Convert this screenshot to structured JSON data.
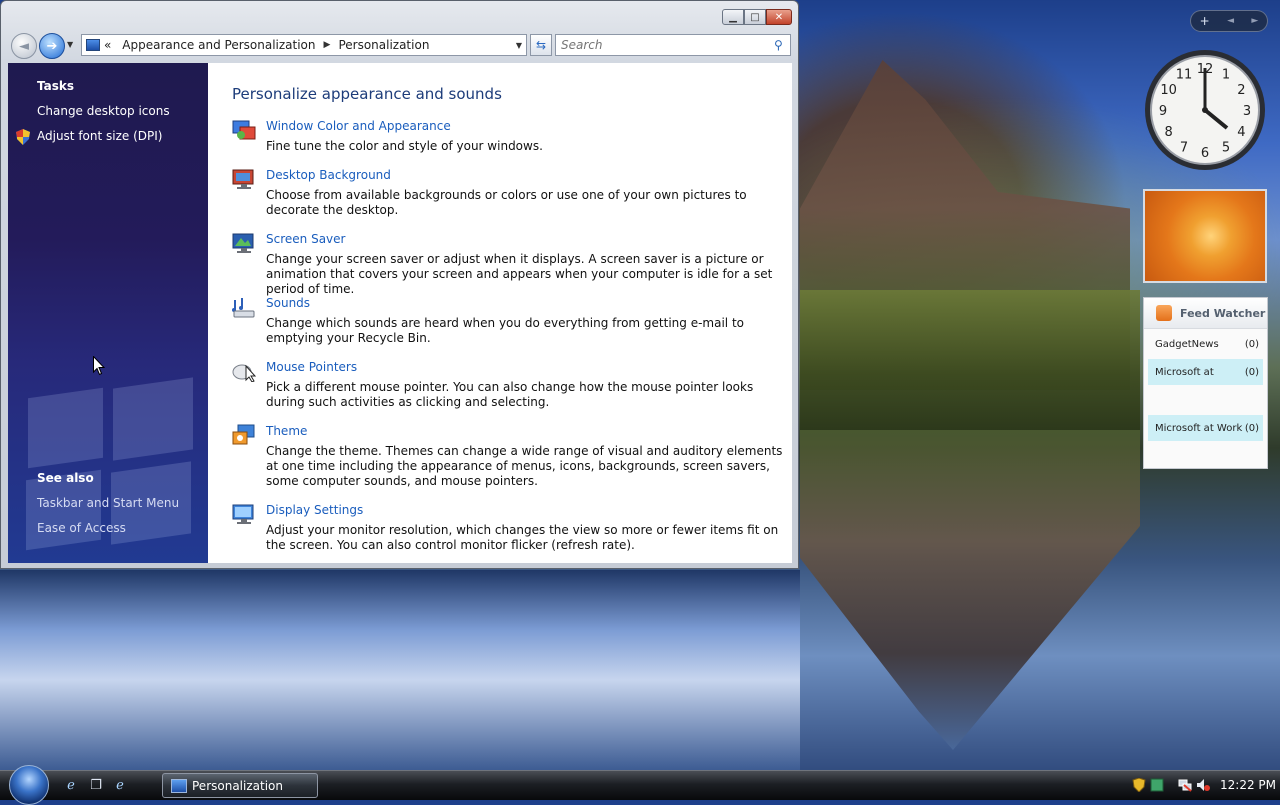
{
  "window": {
    "caption_buttons": [
      "minimize",
      "maximize",
      "close"
    ],
    "address": {
      "overflow": "«",
      "crumbs": [
        "Appearance and Personalization",
        "Personalization"
      ]
    },
    "search_placeholder": "Search"
  },
  "sidebar": {
    "tasks_heading": "Tasks",
    "tasks": [
      "Change desktop icons",
      "Adjust font size (DPI)"
    ],
    "see_also_heading": "See also",
    "see_also": [
      "Taskbar and Start Menu",
      "Ease of Access"
    ]
  },
  "main": {
    "title": "Personalize appearance and sounds",
    "items": [
      {
        "icon": "window-color-icon",
        "title": "Window Color and Appearance",
        "desc": "Fine tune the color and style of your windows."
      },
      {
        "icon": "desktop-background-icon",
        "title": "Desktop Background",
        "desc": "Choose from available backgrounds or colors or use one of your own pictures to decorate the desktop."
      },
      {
        "icon": "screen-saver-icon",
        "title": "Screen Saver",
        "desc": "Change your screen saver or adjust when it displays. A screen saver is a picture or animation that covers your screen and appears when your computer is idle for a set period of time."
      },
      {
        "icon": "sounds-icon",
        "title": "Sounds",
        "desc": "Change which sounds are heard when you do everything from getting e-mail to emptying your Recycle Bin."
      },
      {
        "icon": "mouse-pointers-icon",
        "title": "Mouse Pointers",
        "desc": "Pick a different mouse pointer. You can also change how the mouse pointer looks during such activities as clicking and selecting."
      },
      {
        "icon": "theme-icon",
        "title": "Theme",
        "desc": "Change the theme. Themes can change a wide range of visual and auditory elements at one time including the appearance of menus, icons, backgrounds, screen savers, some computer sounds, and mouse pointers."
      },
      {
        "icon": "display-settings-icon",
        "title": "Display Settings",
        "desc": "Adjust your monitor resolution, which changes the view so more or fewer items fit on the screen. You can also control monitor flicker (refresh rate)."
      }
    ]
  },
  "gadgets": {
    "toolbar": {
      "add": "+",
      "prev": "◄",
      "next": "►"
    },
    "clock_numbers": [
      "12",
      "1",
      "2",
      "3",
      "4",
      "5",
      "6",
      "7",
      "8",
      "9",
      "10",
      "11"
    ],
    "feed": {
      "title": "Feed Watcher",
      "rows": [
        {
          "name": "GadgetNews",
          "count": "(0)"
        },
        {
          "name": "Microsoft at",
          "count": "(0)"
        },
        {
          "name": "Microsoft at Work",
          "count": "(0)"
        }
      ]
    }
  },
  "taskbar": {
    "task_label": "Personalization",
    "time": "12:22 PM"
  }
}
